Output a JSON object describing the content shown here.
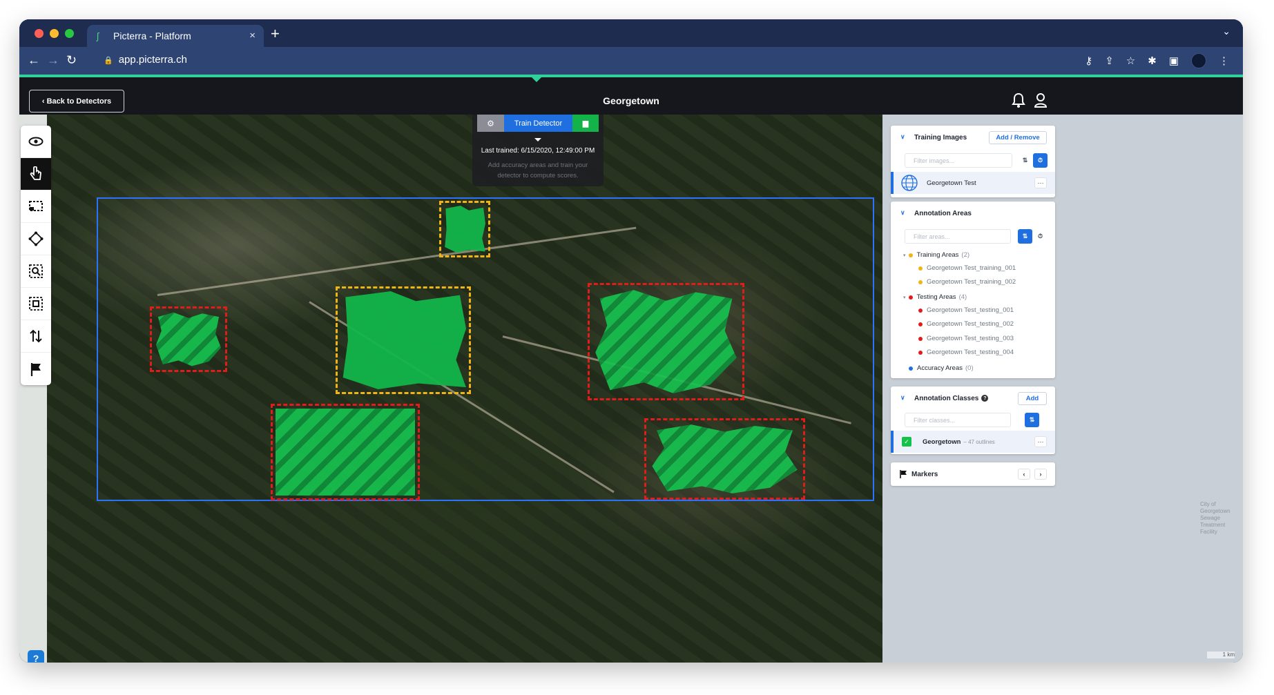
{
  "browser": {
    "tab_title": "Picterra - Platform",
    "tab_close": "×",
    "new_tab": "+",
    "url": "app.picterra.ch"
  },
  "app": {
    "back_label": "‹ Back to Detectors",
    "page_title": "Georgetown",
    "accent": "#2fd29a"
  },
  "train": {
    "button_label": "Train Detector",
    "last_trained": "Last trained: 6/15/2020, 12:49:00 PM",
    "hint": "Add accuracy areas and train your detector to compute scores."
  },
  "panel": {
    "training_images": {
      "title": "Training Images",
      "add_label": "Add / Remove",
      "filter_placeholder": "Filter images...",
      "items": [
        {
          "name": "Georgetown Test"
        }
      ]
    },
    "annotation_areas": {
      "title": "Annotation Areas",
      "filter_placeholder": "Filter areas...",
      "groups": [
        {
          "label": "Training Areas",
          "count": "(2)",
          "color": "#f2b413",
          "items": [
            "Georgetown Test_training_001",
            "Georgetown Test_training_002"
          ]
        },
        {
          "label": "Testing Areas",
          "count": "(4)",
          "color": "#e21b1b",
          "items": [
            "Georgetown Test_testing_001",
            "Georgetown Test_testing_002",
            "Georgetown Test_testing_003",
            "Georgetown Test_testing_004"
          ]
        },
        {
          "label": "Accuracy Areas",
          "count": "(0)",
          "color": "#1f6fe0",
          "items": []
        }
      ]
    },
    "annotation_classes": {
      "title": "Annotation Classes",
      "add_label": "Add",
      "filter_placeholder": "Filter classes...",
      "items": [
        {
          "name": "Georgetown",
          "detail": "– 47 outlines",
          "color": "#14c24a"
        }
      ]
    },
    "markers": {
      "title": "Markers"
    }
  },
  "map_labels": {
    "place": "City of Georgetown Sewage Treatment Facility",
    "scale": "1 km"
  }
}
